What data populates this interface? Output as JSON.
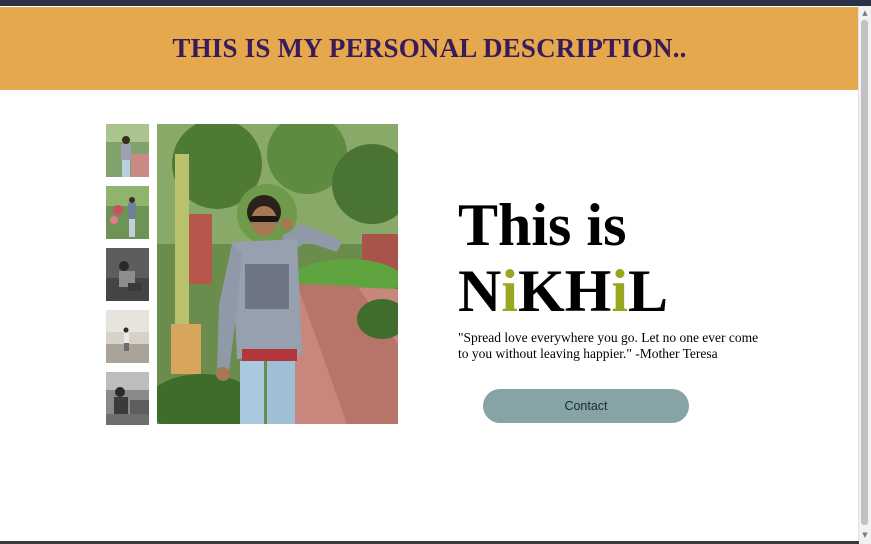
{
  "header": {
    "title": "THIS IS MY PERSONAL DESCRIPTION.."
  },
  "intro": {
    "line1": "This is",
    "name_parts": [
      "N",
      "i",
      "KH",
      "i",
      "L"
    ],
    "quote": "\"Spread love everywhere you go. Let no one ever come to you without leaving happier.\" -Mother Teresa"
  },
  "contact": {
    "label": "Contact"
  },
  "colors": {
    "header_bg": "#e5a84c",
    "header_text": "#3a1b5a",
    "name_accent": "#98a71e",
    "button_bg": "#86a3a6"
  },
  "gallery": {
    "thumb_count": 5
  }
}
